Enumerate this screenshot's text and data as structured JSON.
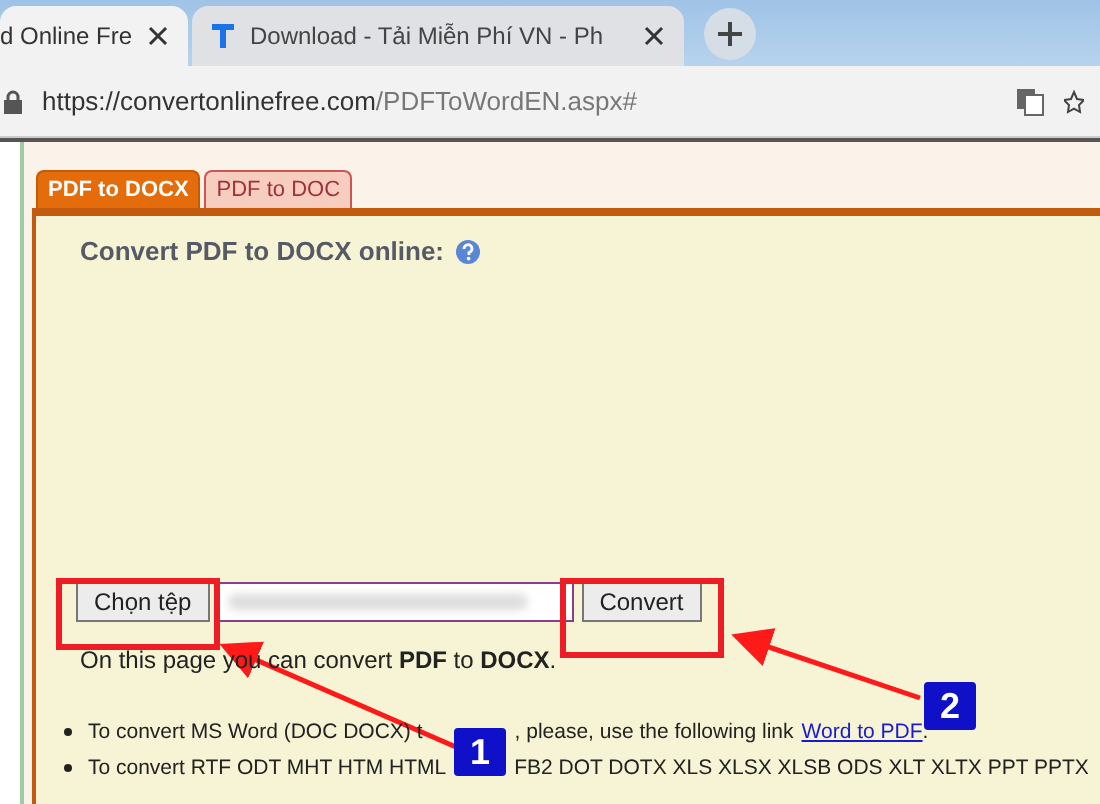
{
  "browser": {
    "tabs": [
      {
        "title": "d Online Fre",
        "selected": true
      },
      {
        "title": "Download - Tải Miễn Phí VN - Ph",
        "selected": false
      }
    ],
    "url": {
      "host": "https://convertonlinefree.com",
      "path": "/PDFToWordEN.aspx#"
    }
  },
  "page": {
    "tabs": [
      {
        "label": "PDF to DOCX",
        "selected": true
      },
      {
        "label": "PDF to DOC",
        "selected": false
      }
    ],
    "heading": "Convert PDF to DOCX online:",
    "choose_button": "Chọn tệp",
    "convert_button": "Convert",
    "intro": "On this page you can convert **PDF** to **DOCX**.",
    "bullets": [
      {
        "parts": [
          "To convert MS Word (DOC DOCX) t",
          ", please, use the following link"
        ],
        "link": "Word to PDF",
        "end": "."
      },
      {
        "parts": [
          "To convert RTF ODT MHT HTM HTML",
          "FB2 DOT DOTX XLS XLSX XLSB ODS XLT XLTX PPT PPTX"
        ]
      }
    ]
  },
  "annotations": [
    {
      "number": "1"
    },
    {
      "number": "2"
    }
  ]
}
